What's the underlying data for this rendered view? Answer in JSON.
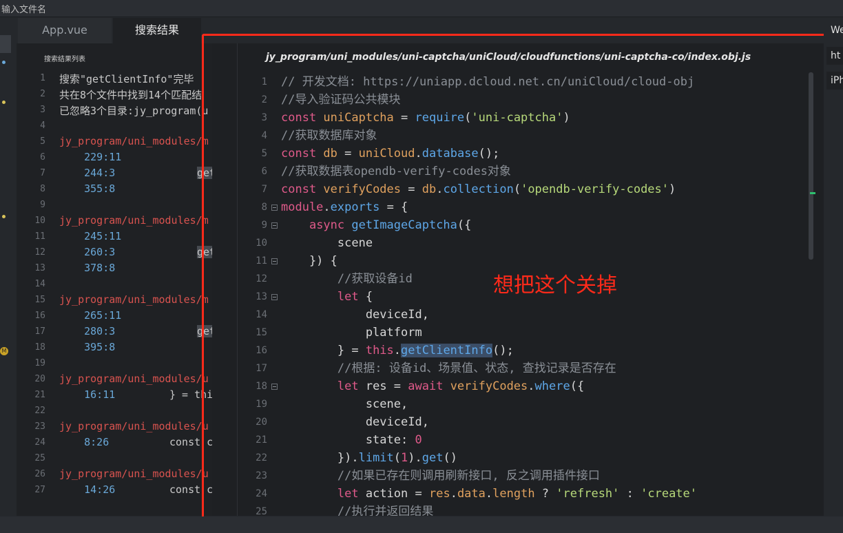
{
  "topbar": {
    "title": "输入文件名"
  },
  "tabs": [
    {
      "label": "App.vue"
    },
    {
      "label": "搜索结果"
    }
  ],
  "results": {
    "list_title": "搜索结果列表",
    "lines": [
      {
        "n": "1",
        "kind": "norm",
        "text": "搜索\"getClientInfo\"完毕"
      },
      {
        "n": "2",
        "kind": "norm",
        "text": "共在8个文件中找到14个匹配结"
      },
      {
        "n": "3",
        "kind": "norm",
        "text": "已忽略3个目录:jy_program(u"
      },
      {
        "n": "4",
        "kind": "norm",
        "text": ""
      },
      {
        "n": "5",
        "kind": "path",
        "text": "jy_program/uni_modules/m"
      },
      {
        "n": "6",
        "kind": "pos",
        "text": "    229:11"
      },
      {
        "n": "7",
        "kind": "pos",
        "text": "    244:3",
        "snip": "getC",
        "hl": true
      },
      {
        "n": "8",
        "kind": "pos",
        "text": "    355:8"
      },
      {
        "n": "9",
        "kind": "norm",
        "text": ""
      },
      {
        "n": "10",
        "kind": "path",
        "text": "jy_program/uni_modules/m"
      },
      {
        "n": "11",
        "kind": "pos",
        "text": "    245:11"
      },
      {
        "n": "12",
        "kind": "pos",
        "text": "    260:3",
        "snip": "getC",
        "hl": true
      },
      {
        "n": "13",
        "kind": "pos",
        "text": "    378:8"
      },
      {
        "n": "14",
        "kind": "norm",
        "text": ""
      },
      {
        "n": "15",
        "kind": "path",
        "text": "jy_program/uni_modules/m"
      },
      {
        "n": "16",
        "kind": "pos",
        "text": "    265:11"
      },
      {
        "n": "17",
        "kind": "pos",
        "text": "    280:3",
        "snip": "getC",
        "hl": true
      },
      {
        "n": "18",
        "kind": "pos",
        "text": "    395:8"
      },
      {
        "n": "19",
        "kind": "norm",
        "text": ""
      },
      {
        "n": "20",
        "kind": "path",
        "text": "jy_program/uni_modules/u"
      },
      {
        "n": "21",
        "kind": "pos",
        "text": "    16:11",
        "snip": "} = this",
        "hl": false
      },
      {
        "n": "22",
        "kind": "norm",
        "text": ""
      },
      {
        "n": "23",
        "kind": "path",
        "text": "jy_program/uni_modules/u"
      },
      {
        "n": "24",
        "kind": "pos",
        "text": "    8:26",
        "snip": "const cl",
        "hl": false
      },
      {
        "n": "25",
        "kind": "norm",
        "text": ""
      },
      {
        "n": "26",
        "kind": "path",
        "text": "jy_program/uni_modules/u"
      },
      {
        "n": "27",
        "kind": "pos",
        "text": "    14:26",
        "snip": "const cl",
        "hl": false
      }
    ]
  },
  "editor": {
    "file_path": "jy_program/uni_modules/uni-captcha/uniCloud/cloudfunctions/uni-captcha-co/index.obj.js",
    "lines": [
      {
        "n": "1",
        "fold": false,
        "tokens": [
          [
            "c",
            "// 开发文档: https://uniapp.dcloud.net.cn/uniCloud/cloud-obj"
          ]
        ]
      },
      {
        "n": "2",
        "fold": false,
        "tokens": [
          [
            "c",
            "//导入验证码公共模块"
          ]
        ]
      },
      {
        "n": "3",
        "fold": false,
        "tokens": [
          [
            "k",
            "const "
          ],
          [
            "v",
            "uniCaptcha"
          ],
          [
            "p",
            " = "
          ],
          [
            "f",
            "require"
          ],
          [
            "p",
            "("
          ],
          [
            "s",
            "'uni-captcha'"
          ],
          [
            "p",
            ")"
          ]
        ]
      },
      {
        "n": "4",
        "fold": false,
        "tokens": [
          [
            "c",
            "//获取数据库对象"
          ]
        ]
      },
      {
        "n": "5",
        "fold": false,
        "tokens": [
          [
            "k",
            "const "
          ],
          [
            "v",
            "db"
          ],
          [
            "p",
            " = "
          ],
          [
            "v",
            "uniCloud"
          ],
          [
            "p",
            "."
          ],
          [
            "f",
            "database"
          ],
          [
            "p",
            "();"
          ]
        ]
      },
      {
        "n": "6",
        "fold": false,
        "tokens": [
          [
            "c",
            "//获取数据表opendb-verify-codes对象"
          ]
        ]
      },
      {
        "n": "7",
        "fold": false,
        "tokens": [
          [
            "k",
            "const "
          ],
          [
            "v",
            "verifyCodes"
          ],
          [
            "p",
            " = "
          ],
          [
            "v",
            "db"
          ],
          [
            "p",
            "."
          ],
          [
            "f",
            "collection"
          ],
          [
            "p",
            "("
          ],
          [
            "s",
            "'opendb-verify-codes'"
          ],
          [
            "p",
            ")"
          ]
        ]
      },
      {
        "n": "8",
        "fold": true,
        "tokens": [
          [
            "k",
            "module"
          ],
          [
            "p",
            "."
          ],
          [
            "f",
            "exports"
          ],
          [
            "p",
            " = {"
          ]
        ]
      },
      {
        "n": "9",
        "fold": true,
        "tokens": [
          [
            "p",
            "    "
          ],
          [
            "k",
            "async "
          ],
          [
            "f",
            "getImageCaptcha"
          ],
          [
            "p",
            "({"
          ]
        ]
      },
      {
        "n": "10",
        "fold": false,
        "tokens": [
          [
            "p",
            "        scene"
          ]
        ]
      },
      {
        "n": "11",
        "fold": true,
        "tokens": [
          [
            "p",
            "    }) {"
          ]
        ]
      },
      {
        "n": "12",
        "fold": false,
        "tokens": [
          [
            "p",
            "        "
          ],
          [
            "c",
            "//获取设备id"
          ]
        ]
      },
      {
        "n": "13",
        "fold": true,
        "tokens": [
          [
            "p",
            "        "
          ],
          [
            "k",
            "let "
          ],
          [
            "p",
            "{"
          ]
        ]
      },
      {
        "n": "14",
        "fold": false,
        "tokens": [
          [
            "p",
            "            deviceId,"
          ]
        ]
      },
      {
        "n": "15",
        "fold": false,
        "tokens": [
          [
            "p",
            "            platform"
          ]
        ]
      },
      {
        "n": "16",
        "fold": false,
        "tokens": [
          [
            "p",
            "        } = "
          ],
          [
            "k",
            "this"
          ],
          [
            "p",
            "."
          ],
          [
            "fh",
            "getClientInfo"
          ],
          [
            "p",
            "();"
          ]
        ]
      },
      {
        "n": "17",
        "fold": false,
        "tokens": [
          [
            "p",
            "        "
          ],
          [
            "c",
            "//根据: 设备id、场景值、状态, 查找记录是否存在"
          ]
        ]
      },
      {
        "n": "18",
        "fold": true,
        "tokens": [
          [
            "p",
            "        "
          ],
          [
            "k",
            "let "
          ],
          [
            "p",
            "res = "
          ],
          [
            "k",
            "await "
          ],
          [
            "v",
            "verifyCodes"
          ],
          [
            "p",
            "."
          ],
          [
            "f",
            "where"
          ],
          [
            "p",
            "({"
          ]
        ]
      },
      {
        "n": "19",
        "fold": false,
        "tokens": [
          [
            "p",
            "            scene,"
          ]
        ]
      },
      {
        "n": "20",
        "fold": false,
        "tokens": [
          [
            "p",
            "            deviceId,"
          ]
        ]
      },
      {
        "n": "21",
        "fold": false,
        "tokens": [
          [
            "p",
            "            state: "
          ],
          [
            "n",
            "0"
          ]
        ]
      },
      {
        "n": "22",
        "fold": false,
        "tokens": [
          [
            "p",
            "        })."
          ],
          [
            "f",
            "limit"
          ],
          [
            "p",
            "("
          ],
          [
            "n",
            "1"
          ],
          [
            "p",
            ")."
          ],
          [
            "f",
            "get"
          ],
          [
            "p",
            "()"
          ]
        ]
      },
      {
        "n": "23",
        "fold": false,
        "tokens": [
          [
            "p",
            "        "
          ],
          [
            "c",
            "//如果已存在则调用刷新接口, 反之调用插件接口"
          ]
        ]
      },
      {
        "n": "24",
        "fold": false,
        "tokens": [
          [
            "p",
            "        "
          ],
          [
            "k",
            "let "
          ],
          [
            "p",
            "action = "
          ],
          [
            "v",
            "res"
          ],
          [
            "p",
            "."
          ],
          [
            "v",
            "data"
          ],
          [
            "p",
            "."
          ],
          [
            "v",
            "length"
          ],
          [
            "p",
            " ? "
          ],
          [
            "s",
            "'refresh'"
          ],
          [
            "p",
            " : "
          ],
          [
            "s",
            "'create'"
          ]
        ]
      },
      {
        "n": "25",
        "fold": false,
        "tokens": [
          [
            "p",
            "        "
          ],
          [
            "c",
            "//执行并返回结果"
          ]
        ]
      }
    ]
  },
  "annotation": "想把这个关掉",
  "right_panel": {
    "labels": [
      "We",
      "ht",
      "iPh"
    ]
  },
  "colors": {
    "annotation_red": "#ff2a1a",
    "keyword": "#e05a8a",
    "function": "#5ea7e8",
    "string": "#b7d97a"
  }
}
